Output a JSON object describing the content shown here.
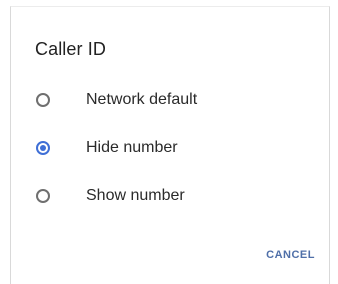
{
  "dialog": {
    "title": "Caller ID",
    "options": [
      {
        "label": "Network default",
        "selected": false
      },
      {
        "label": "Hide number",
        "selected": true
      },
      {
        "label": "Show number",
        "selected": false
      }
    ],
    "cancel_label": "CANCEL"
  },
  "colors": {
    "accent": "#3f6fd6",
    "radio_unselected": "#6f6f6f",
    "text": "#2a2a2a",
    "button_text": "#4f6fa8"
  }
}
